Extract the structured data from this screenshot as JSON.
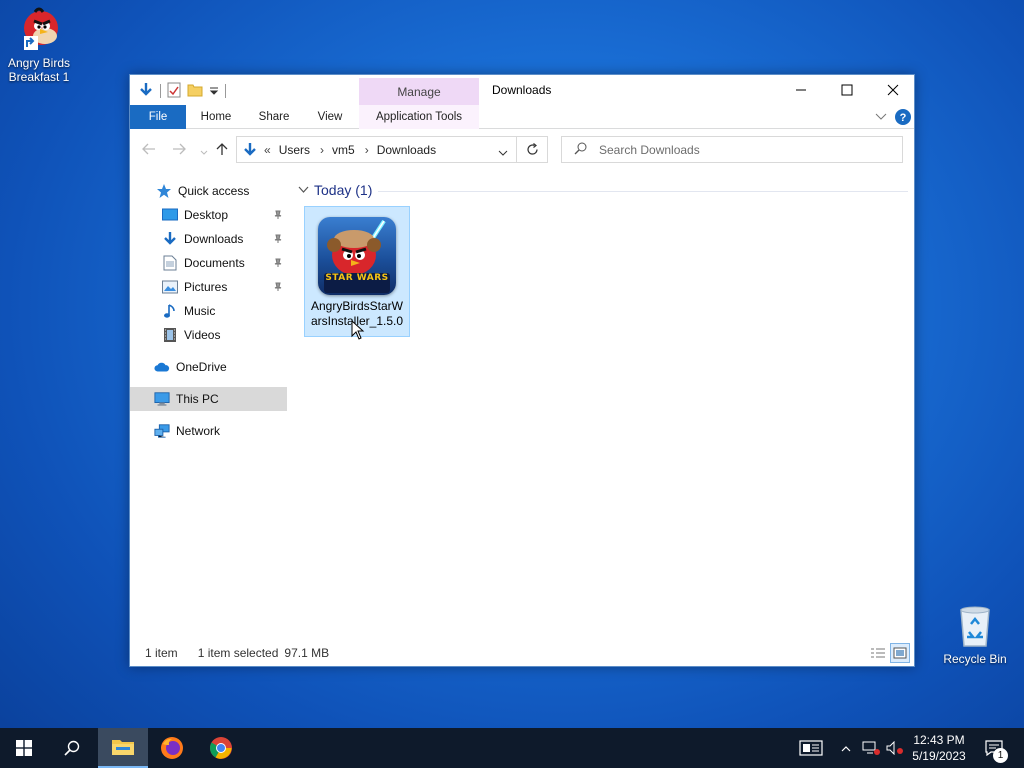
{
  "desktop": {
    "icons": [
      {
        "label": "Angry Birds Breakfast 1"
      },
      {
        "label": "Recycle Bin"
      }
    ]
  },
  "window": {
    "title": "Downloads",
    "manage_tab": "Manage",
    "ribbon_tabs": [
      "File",
      "Home",
      "Share",
      "View",
      "Application Tools"
    ],
    "breadcrumb": [
      "Users",
      "vm5",
      "Downloads"
    ],
    "breadcrumb_prefix": "«",
    "search_placeholder": "Search Downloads",
    "nav": {
      "quick_access": "Quick access",
      "items": [
        "Desktop",
        "Downloads",
        "Documents",
        "Pictures",
        "Music",
        "Videos"
      ],
      "onedrive": "OneDrive",
      "this_pc": "This PC",
      "network": "Network"
    },
    "group_header": "Today (1)",
    "file": {
      "name": "AngryBirdsStarWarsInstaller_1.5.0",
      "thumb_text": "STAR WARS"
    },
    "status": {
      "count": "1 item",
      "selected": "1 item selected",
      "size": "97.1 MB"
    }
  },
  "taskbar": {
    "time": "12:43 PM",
    "date": "5/19/2023",
    "notification_count": "1"
  },
  "colors": {
    "accent": "#1a6bc2",
    "manage_tab": "#efd9f6",
    "selection": "#cce8ff",
    "taskbar": "#0e1a2b"
  }
}
